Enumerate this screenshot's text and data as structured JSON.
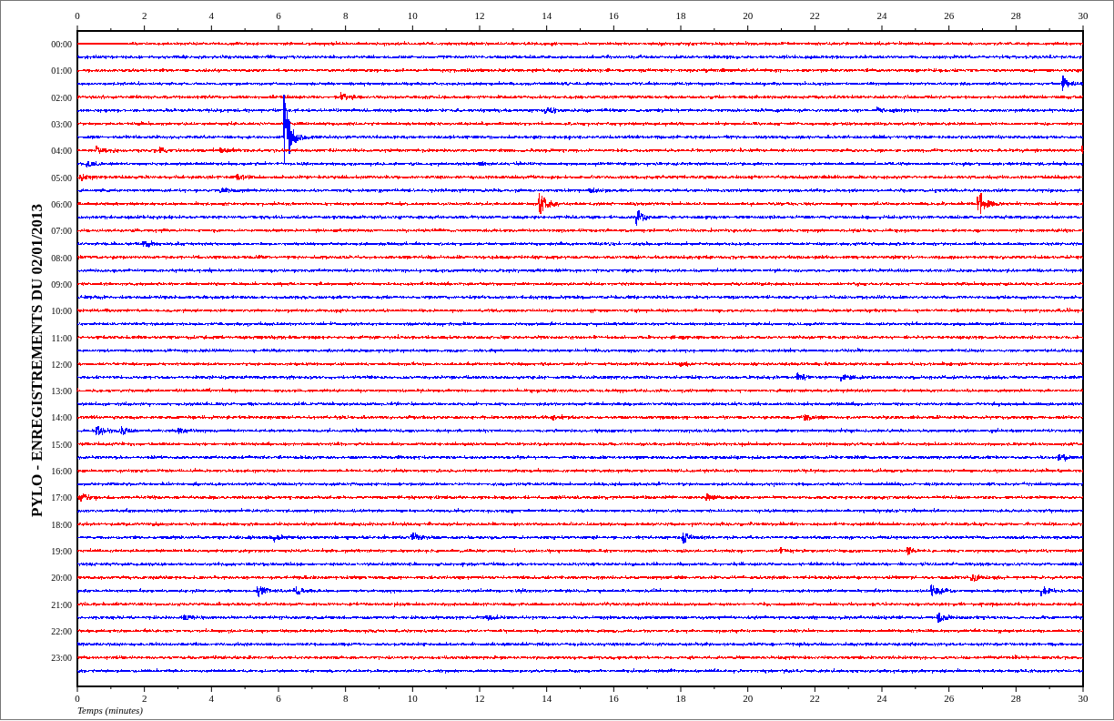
{
  "plot": {
    "title": "PYLO - ENREGISTREMENTS DU 02/01/2013",
    "xlabel": "Temps (minutes)",
    "top_ticks": [
      "0",
      "2",
      "4",
      "6",
      "8",
      "10",
      "12",
      "14",
      "16",
      "18",
      "20",
      "22",
      "24",
      "26",
      "28",
      "30"
    ],
    "bottom_ticks": [
      "0",
      "2",
      "4",
      "6",
      "8",
      "10",
      "12",
      "14",
      "16",
      "18",
      "20",
      "22",
      "24",
      "26",
      "28",
      "30"
    ],
    "hours": [
      {
        "label": "00:00",
        "traces": [
          {
            "color": "#ff0000"
          },
          {
            "color": "#0000ff"
          }
        ]
      },
      {
        "label": "01:00",
        "traces": [
          {
            "color": "#ff0000"
          },
          {
            "color": "#0000ff"
          }
        ]
      },
      {
        "label": "02:00",
        "traces": [
          {
            "color": "#ff0000"
          },
          {
            "color": "#0000ff"
          }
        ]
      },
      {
        "label": "03:00",
        "traces": [
          {
            "color": "#ff0000"
          },
          {
            "color": "#0000ff"
          }
        ]
      },
      {
        "label": "04:00",
        "traces": [
          {
            "color": "#ff0000"
          },
          {
            "color": "#0000ff"
          }
        ]
      },
      {
        "label": "05:00",
        "traces": [
          {
            "color": "#ff0000"
          },
          {
            "color": "#0000ff"
          }
        ]
      },
      {
        "label": "06:00",
        "traces": [
          {
            "color": "#ff0000"
          },
          {
            "color": "#0000ff"
          }
        ]
      },
      {
        "label": "07:00",
        "traces": [
          {
            "color": "#ff0000"
          },
          {
            "color": "#0000ff"
          }
        ]
      },
      {
        "label": "08:00",
        "traces": [
          {
            "color": "#ff0000"
          },
          {
            "color": "#0000ff"
          }
        ]
      },
      {
        "label": "09:00",
        "traces": [
          {
            "color": "#ff0000"
          },
          {
            "color": "#0000ff"
          }
        ]
      },
      {
        "label": "10:00",
        "traces": [
          {
            "color": "#ff0000"
          },
          {
            "color": "#0000ff"
          }
        ]
      },
      {
        "label": "11:00",
        "traces": [
          {
            "color": "#ff0000"
          },
          {
            "color": "#0000ff"
          }
        ]
      },
      {
        "label": "12:00",
        "traces": [
          {
            "color": "#ff0000"
          },
          {
            "color": "#0000ff"
          }
        ]
      },
      {
        "label": "13:00",
        "traces": [
          {
            "color": "#ff0000"
          },
          {
            "color": "#0000ff"
          }
        ]
      },
      {
        "label": "14:00",
        "traces": [
          {
            "color": "#ff0000"
          },
          {
            "color": "#0000ff"
          }
        ]
      },
      {
        "label": "15:00",
        "traces": [
          {
            "color": "#ff0000"
          },
          {
            "color": "#0000ff"
          }
        ]
      },
      {
        "label": "16:00",
        "traces": [
          {
            "color": "#ff0000"
          },
          {
            "color": "#0000ff"
          }
        ]
      },
      {
        "label": "17:00",
        "traces": [
          {
            "color": "#ff0000"
          },
          {
            "color": "#0000ff"
          }
        ]
      },
      {
        "label": "18:00",
        "traces": [
          {
            "color": "#ff0000"
          },
          {
            "color": "#0000ff"
          }
        ]
      },
      {
        "label": "19:00",
        "traces": [
          {
            "color": "#ff0000"
          },
          {
            "color": "#0000ff"
          }
        ]
      },
      {
        "label": "20:00",
        "traces": [
          {
            "color": "#ff0000"
          },
          {
            "color": "#0000ff"
          }
        ]
      },
      {
        "label": "21:00",
        "traces": [
          {
            "color": "#ff0000"
          },
          {
            "color": "#0000ff"
          }
        ]
      },
      {
        "label": "22:00",
        "traces": [
          {
            "color": "#ff0000"
          },
          {
            "color": "#0000ff"
          }
        ]
      },
      {
        "label": "23:00",
        "traces": [
          {
            "color": "#ff0000"
          },
          {
            "color": "#0000ff"
          }
        ]
      }
    ]
  }
}
